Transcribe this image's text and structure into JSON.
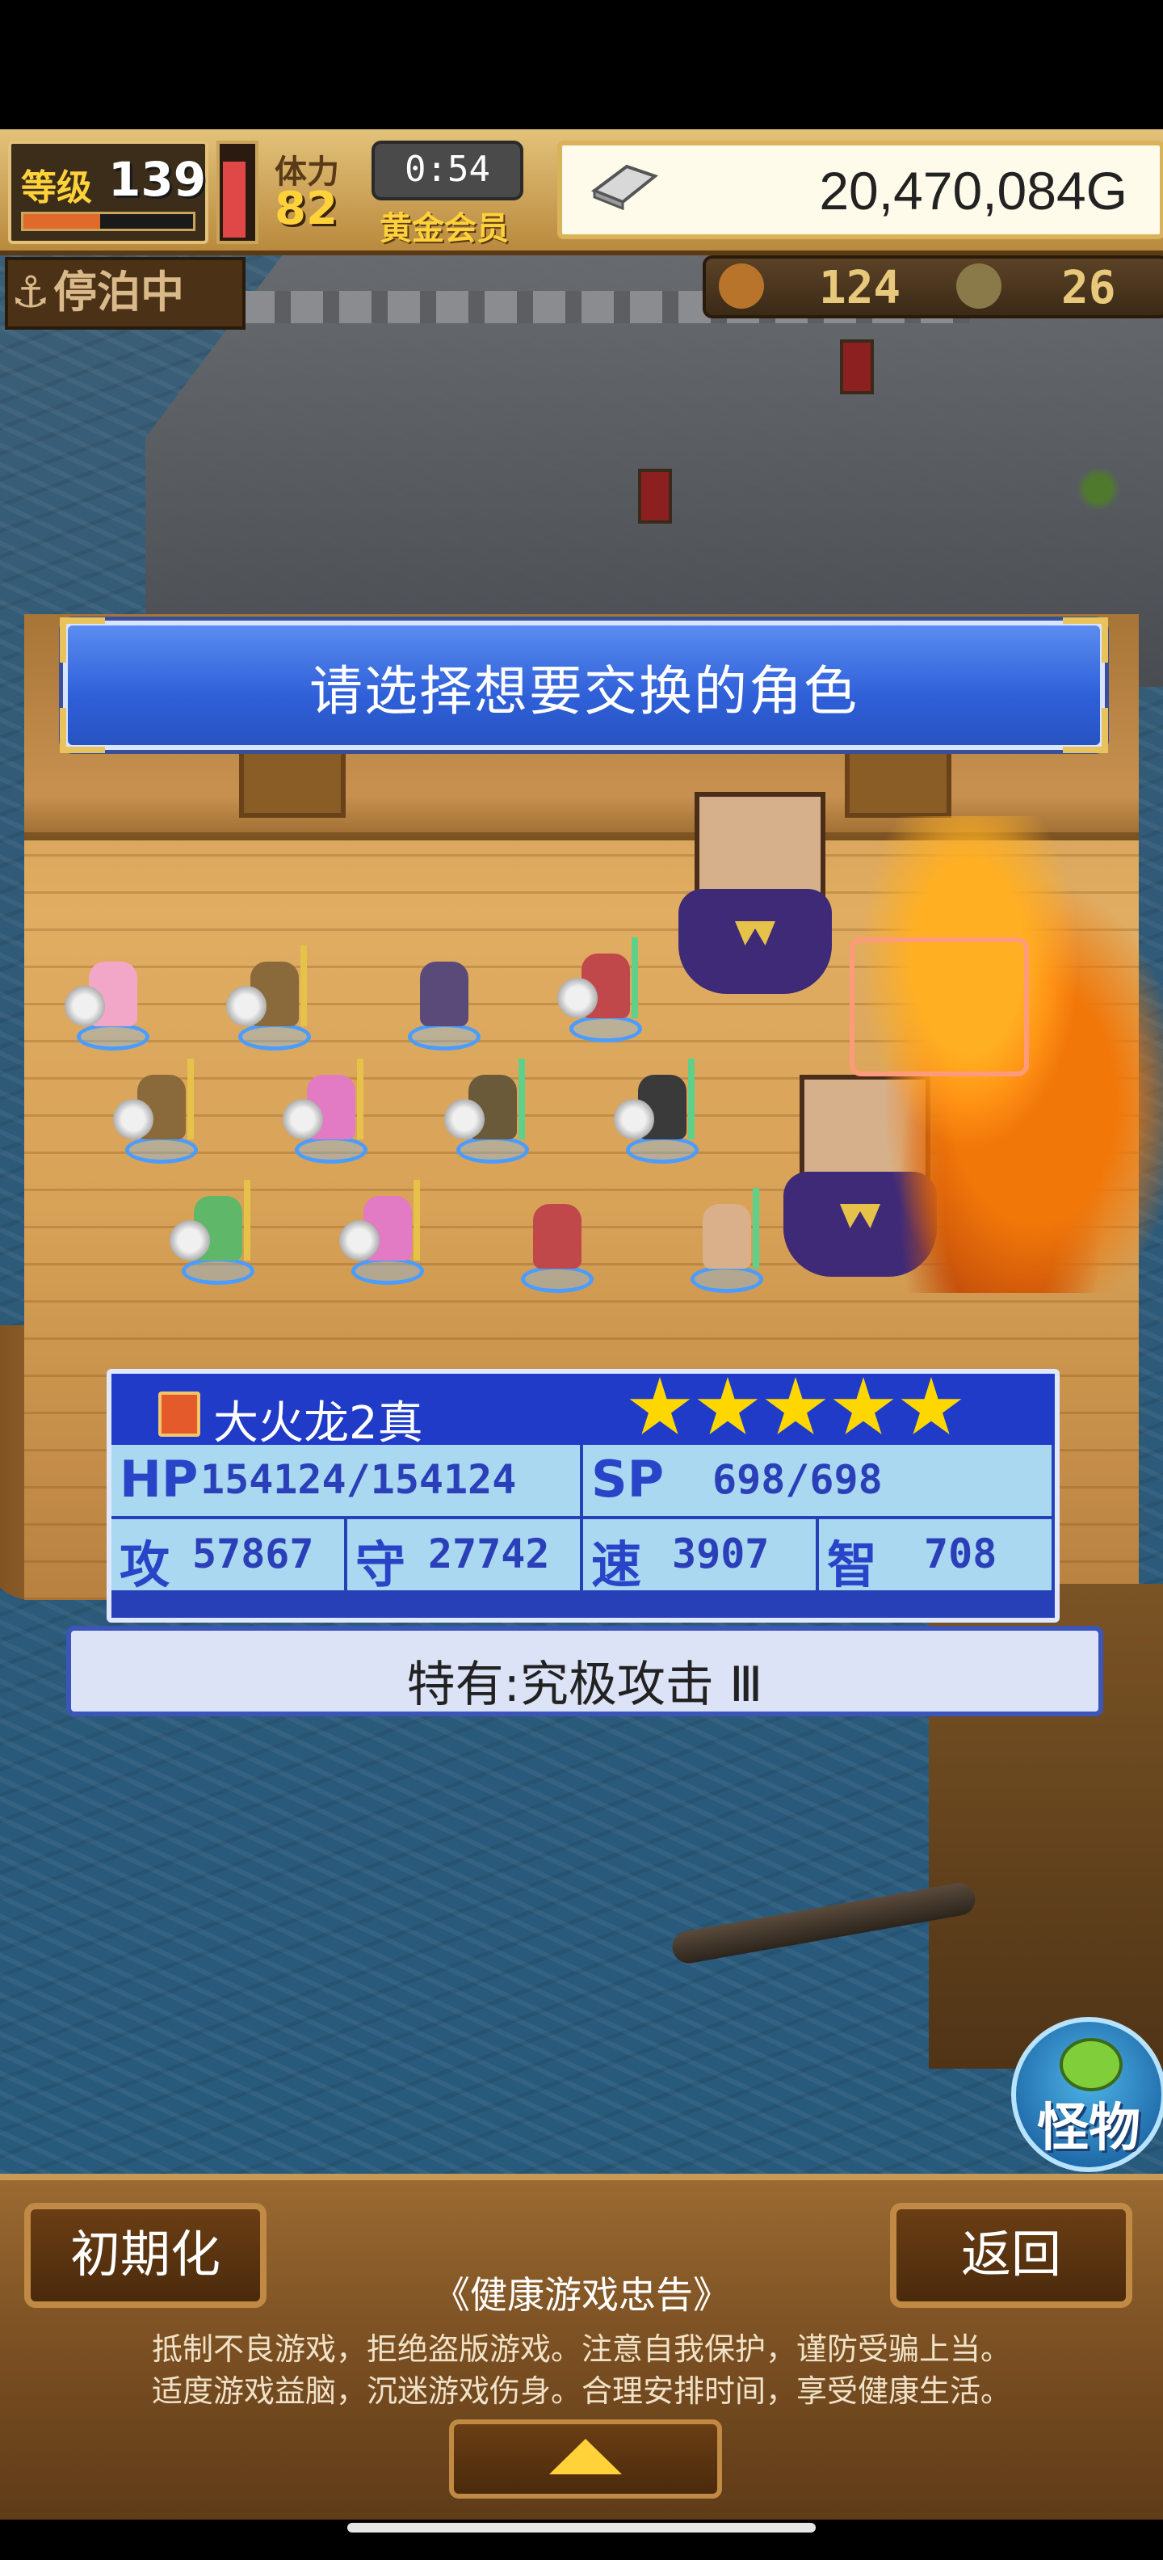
{
  "hud": {
    "level_label": "等级",
    "level_value": "139",
    "exp_fraction": 0.45,
    "hp_fraction": 0.9,
    "stamina_label": "体力",
    "stamina_value": "82",
    "timer": "0:54",
    "membership": "黄金会员",
    "gold": "20,470,084G"
  },
  "status": {
    "mooring": "停泊中",
    "resource_1": "124",
    "resource_2": "26"
  },
  "prompt": "请选择想要交换的角色",
  "unit": {
    "name": "大火龙2真",
    "stars": 5,
    "hp_label": "HP",
    "hp": "154124/154124",
    "sp_label": "SP",
    "sp": "698/698",
    "atk_label": "攻",
    "atk": "57867",
    "def_label": "守",
    "def": "27742",
    "spd_label": "速",
    "spd": "3907",
    "int_label": "智",
    "int": "708"
  },
  "ability": "特有:究极攻击 Ⅲ",
  "monster_button": "怪物",
  "bottom": {
    "reset_label": "初期化",
    "back_label": "返回",
    "advisory_title": "《健康游戏忠告》",
    "advisory_line1": "抵制不良游戏，拒绝盗版游戏。注意自我保护，谨防受骗上当。",
    "advisory_line2": "适度游戏益脑，沉迷游戏伤身。合理安排时间，享受健康生活。"
  },
  "colors": {
    "banner_blue": "#2f5fd8",
    "stats_blue": "#2740b8",
    "stat_cell": "#a9d8f0",
    "star_gold": "#ffd700",
    "wood": "#7a4f22"
  }
}
